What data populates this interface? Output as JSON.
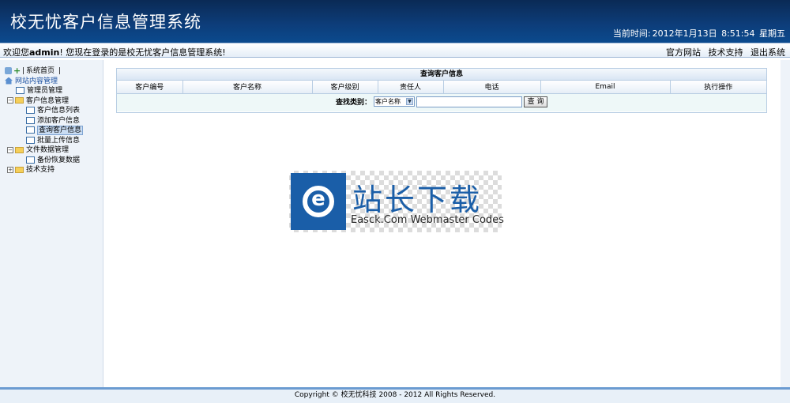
{
  "header": {
    "title": "校无忧客户信息管理系统",
    "time_label": "当前时间:",
    "date": "2012年1月13日",
    "time": "8:51:54",
    "weekday": "星期五"
  },
  "welcome": {
    "prefix": "欢迎您",
    "user": "admin",
    "suffix": "! 您现在登录的是校无忧客户信息管理系统!",
    "links": [
      "官方网站",
      "技术支持",
      "退出系统"
    ]
  },
  "sidebar": {
    "system_home": "系统首页",
    "items": [
      {
        "label": "网站内容管理",
        "level": 0
      },
      {
        "label": "管理员管理",
        "level": 1
      },
      {
        "label": "客户信息管理",
        "level": 1
      },
      {
        "label": "客户信息列表",
        "level": 2
      },
      {
        "label": "添加客户信息",
        "level": 2
      },
      {
        "label": "查询客户信息",
        "level": 2
      },
      {
        "label": "批量上传信息",
        "level": 2
      },
      {
        "label": "文件数据管理",
        "level": 1
      },
      {
        "label": "备份恢复数据",
        "level": 2
      },
      {
        "label": "技术支持",
        "level": 1
      }
    ]
  },
  "panel": {
    "title": "查询客户信息",
    "columns": [
      "客户编号",
      "客户名称",
      "客户级别",
      "责任人",
      "电话",
      "Email",
      "执行操作"
    ],
    "search_label": "查找类别：",
    "search_option": "客户名称",
    "search_button": "查 询"
  },
  "watermark": {
    "cn": "站长下载",
    "en": "Easck.Com Webmaster Codes"
  },
  "footer": {
    "text": "Copyright © 校无忧科技  2008 - 2012 All Rights Reserved."
  },
  "colors": {
    "header_bg": "#0d3c78",
    "accent": "#1a5ea8",
    "sidebar_bg": "#eef3f9"
  }
}
